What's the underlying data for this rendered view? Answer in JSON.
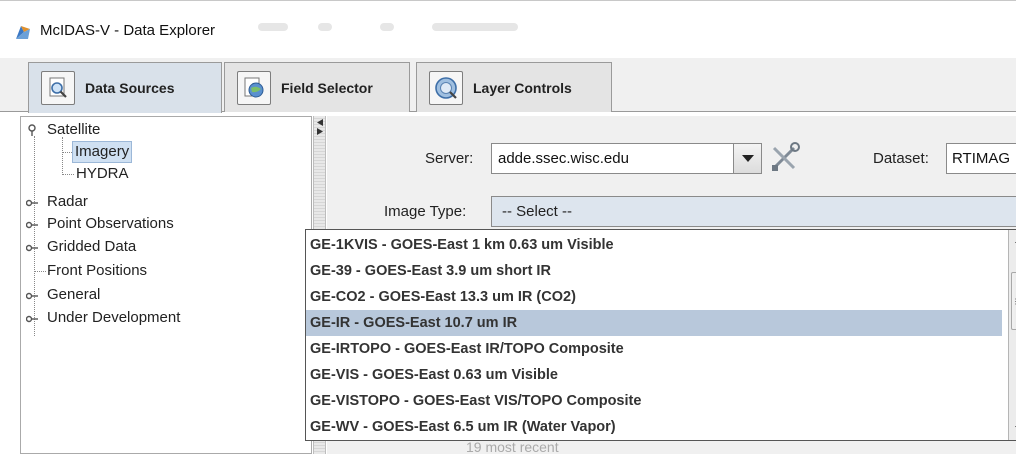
{
  "window": {
    "title": "McIDAS-V - Data Explorer"
  },
  "tabs": [
    {
      "label": "Data Sources",
      "icon": "magnifier-icon",
      "active": true
    },
    {
      "label": "Field Selector",
      "icon": "globe-icon",
      "active": false
    },
    {
      "label": "Layer Controls",
      "icon": "layers-icon",
      "active": false
    }
  ],
  "tree": {
    "items": [
      {
        "label": "Satellite",
        "expanded": true
      },
      {
        "label": "Imagery",
        "selected": true
      },
      {
        "label": "HYDRA"
      },
      {
        "label": "Radar"
      },
      {
        "label": "Point Observations"
      },
      {
        "label": "Gridded Data"
      },
      {
        "label": "Front Positions"
      },
      {
        "label": "General"
      },
      {
        "label": "Under Development"
      }
    ]
  },
  "form": {
    "server_label": "Server:",
    "server_value": "adde.ssec.wisc.edu",
    "dataset_label": "Dataset:",
    "dataset_value": "RTIMAG",
    "image_type_label": "Image Type:",
    "image_type_value": "-- Select --",
    "partial_text": "19 most recent"
  },
  "dropdown": {
    "selected_index": 3,
    "items": [
      "GE-1KVIS - GOES-East 1 km 0.63 um Visible",
      "GE-39 - GOES-East 3.9 um short IR",
      "GE-CO2 - GOES-East 13.3 um IR (CO2)",
      "GE-IR - GOES-East 10.7 um IR",
      "GE-IRTOPO - GOES-East IR/TOPO Composite",
      "GE-VIS - GOES-East 0.63 um Visible",
      "GE-VISTOPO - GOES-East VIS/TOPO Composite",
      "GE-WV - GOES-East 6.5 um IR (Water Vapor)"
    ]
  },
  "colors": {
    "selection": "#b8c8db",
    "tree_selection": "#cfe0f2",
    "active_tab": "#d9e1ea"
  }
}
